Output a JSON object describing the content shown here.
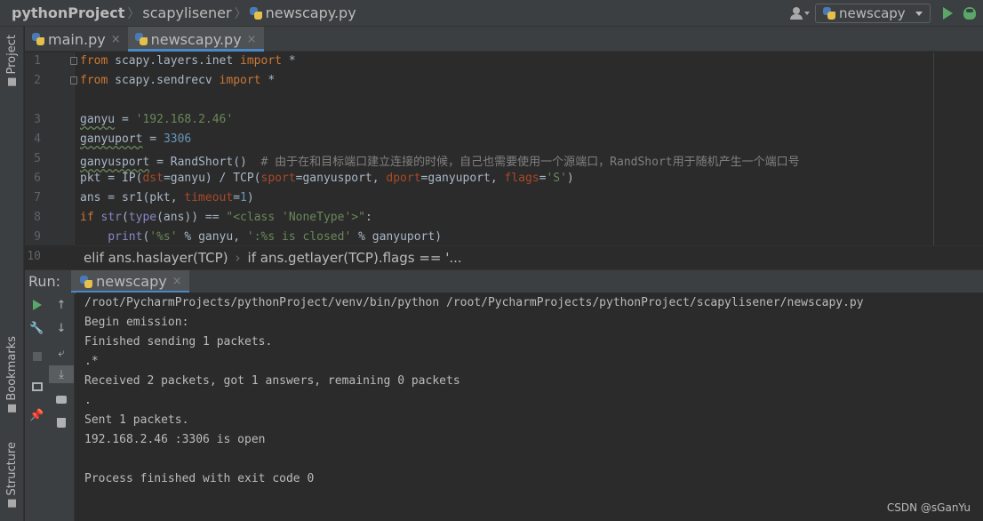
{
  "nav": {
    "project": "pythonProject",
    "folder": "scapylisener",
    "file": "newscapy.py",
    "run_config": "newscapy"
  },
  "sidebar": {
    "project_label": "Project",
    "bookmarks_label": "Bookmarks",
    "structure_label": "Structure"
  },
  "editor": {
    "tabs": [
      {
        "label": "main.py",
        "close": "×"
      },
      {
        "label": "newscapy.py",
        "close": "×"
      }
    ],
    "line_numbers": [
      "1",
      "2",
      "3",
      "4",
      "5",
      "6",
      "7",
      "8",
      "9",
      "10"
    ],
    "code": {
      "l1": {
        "kw1": "from",
        "mod": " scapy.layers.inet ",
        "kw2": "import",
        "rest": " *"
      },
      "l2": {
        "kw1": "from",
        "mod": " scapy.sendrecv ",
        "kw2": "import",
        "rest": " *"
      },
      "l4": {
        "var": "ganyu",
        "eq": " = ",
        "val": "'192.168.2.46'"
      },
      "l5": {
        "var": "ganyuport",
        "eq": " = ",
        "val": "3306"
      },
      "l6": {
        "var": "ganyusport",
        "eq": " = RandShort()  ",
        "comment": "# 由于在和目标端口建立连接的时候，自己也需要使用一个源端口，RandShort用于随机产生一个端口号"
      },
      "l7": {
        "a": "pkt = IP(",
        "p1": "dst",
        "b": "=ganyu) / TCP(",
        "p2": "sport",
        "c": "=ganyusport, ",
        "p3": "dport",
        "d": "=ganyuport, ",
        "p4": "flags",
        "e": "=",
        "s": "'S'",
        "f": ")"
      },
      "l8": {
        "a": "ans = sr1(pkt, ",
        "p": "timeout",
        "b": "=",
        "n": "1",
        "c": ")"
      },
      "l9": {
        "kw": "if",
        "b1": " str",
        "a": "(",
        "b2": "type",
        "b": "(ans)) == ",
        "s": "\"<class 'NoneType'>\"",
        "c": ":"
      },
      "l10": {
        "b": "    print",
        "a": "(",
        "s1": "'%s'",
        "m": " % ganyu, ",
        "s2": "':%s is closed'",
        "e": " % ganyuport)"
      }
    }
  },
  "breadcrumbs": {
    "item1": "elif ans.haslayer(TCP)",
    "sep": "›",
    "item2": "if ans.getlayer(TCP).flags == '..."
  },
  "run": {
    "label": "Run:",
    "tab": "newscapy",
    "close": "×",
    "output": [
      "/root/PycharmProjects/pythonProject/venv/bin/python /root/PycharmProjects/pythonProject/scapylisener/newscapy.py",
      "Begin emission:",
      "Finished sending 1 packets.",
      ".*",
      "Received 2 packets, got 1 answers, remaining 0 packets",
      ".",
      "Sent 1 packets.",
      "192.168.2.46 :3306 is open",
      "",
      "Process finished with exit code 0"
    ]
  },
  "watermark": "CSDN @sGanYu",
  "colors": {
    "keyword": "#cc7832",
    "string": "#6a8759",
    "number": "#6897bb",
    "param": "#aa4926",
    "comment": "#808080",
    "accent": "#4a88c7",
    "run_green": "#59a869"
  }
}
